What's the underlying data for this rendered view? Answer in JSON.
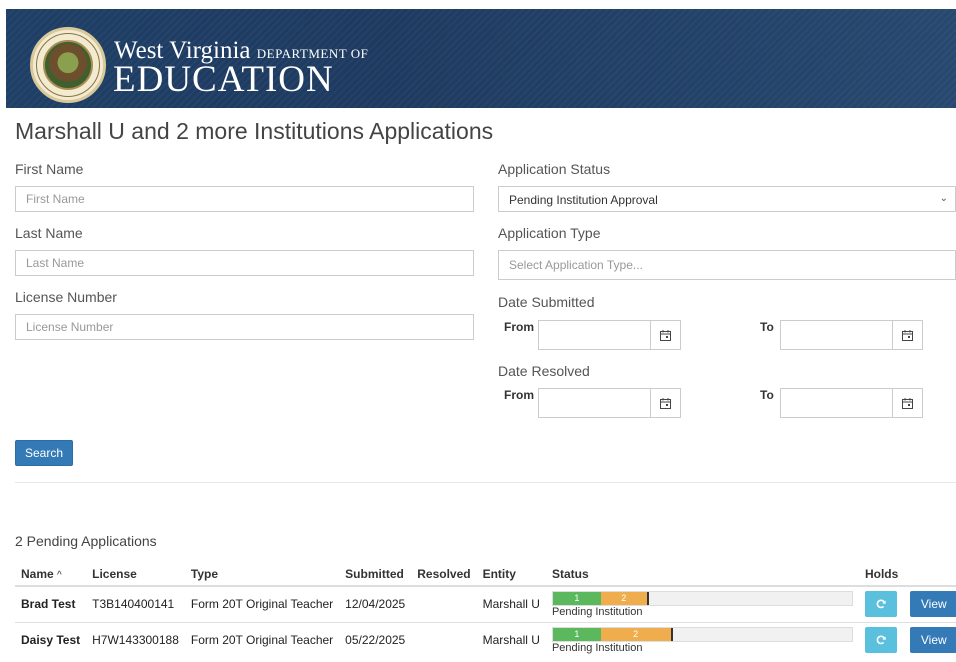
{
  "header": {
    "brand_line1": "West Virginia",
    "brand_line1_small": "DEPARTMENT OF",
    "brand_line2": "EDUCATION",
    "seal_label": "STATE OF WEST VIRGINIA"
  },
  "page": {
    "title": "Marshall U and 2 more Institutions Applications"
  },
  "form": {
    "first_name_label": "First Name",
    "first_name_placeholder": "First Name",
    "last_name_label": "Last Name",
    "last_name_placeholder": "Last Name",
    "license_label": "License Number",
    "license_placeholder": "License Number",
    "status_label": "Application Status",
    "status_value": "Pending Institution Approval",
    "type_label": "Application Type",
    "type_placeholder": "Select Application Type...",
    "submitted_label": "Date Submitted",
    "resolved_label": "Date Resolved",
    "from_label": "From",
    "to_label": "To",
    "search_label": "Search"
  },
  "results": {
    "title": "2 Pending Applications",
    "columns": [
      "Name",
      "License",
      "Type",
      "Submitted",
      "Resolved",
      "Entity",
      "Status",
      "Holds"
    ],
    "sort_indicator": "^",
    "view_label": "View",
    "rows": [
      {
        "name": "Brad Test",
        "license": "T3B140400141",
        "type": "Form 20T Original Teacher",
        "submitted": "12/04/2025",
        "resolved": "",
        "entity": "Marshall U",
        "status_text": "Pending Institution",
        "step1": "1",
        "step2": "2",
        "progress_step1": 0.16,
        "progress_step2": 0.16
      },
      {
        "name": "Daisy Test",
        "license": "H7W143300188",
        "type": "Form 20T Original Teacher",
        "submitted": "05/22/2025",
        "resolved": "",
        "entity": "Marshall U",
        "status_text": "Pending Institution",
        "step1": "1",
        "step2": "2",
        "progress_step1": 0.16,
        "progress_step2": 0.24
      }
    ]
  },
  "colors": {
    "banner": "#1f3f66",
    "primary": "#337ab7",
    "info": "#5bc0de",
    "success": "#5cb85c",
    "warning": "#f0ad4e"
  },
  "icons": {
    "calendar": "calendar-icon",
    "refresh": "refresh-icon",
    "select_caret": "chevron-down-icon"
  }
}
